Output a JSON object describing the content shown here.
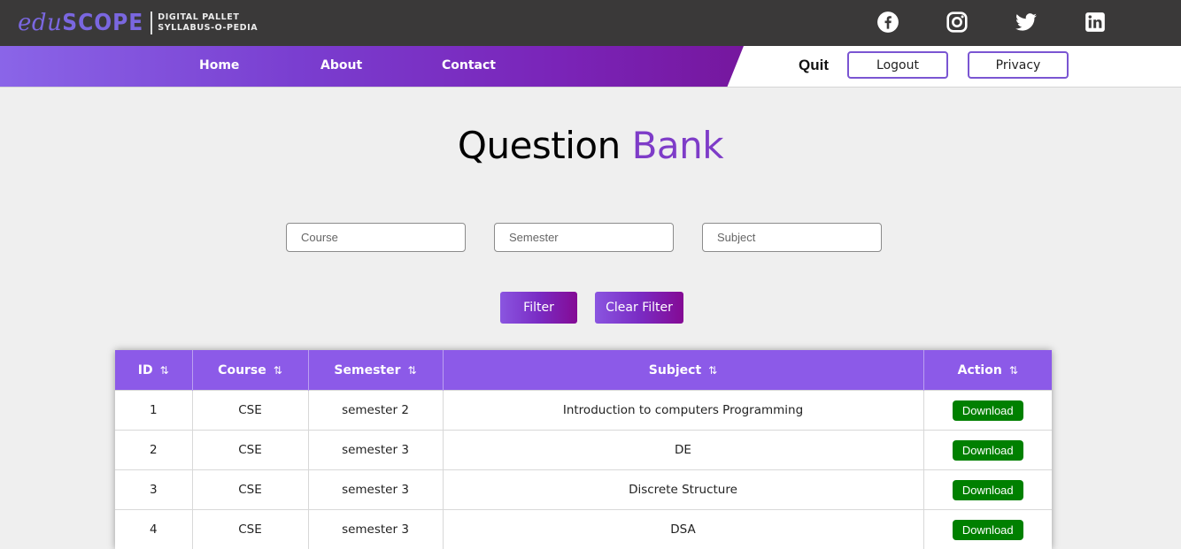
{
  "logo": {
    "main_lower": "edu",
    "main_upper": "SCOPE",
    "sub_line1": "DIGITAL PALLET",
    "sub_line2": "SYLLABUS-O-PEDIA"
  },
  "socials": [
    {
      "icon": "facebook-icon"
    },
    {
      "icon": "instagram-icon"
    },
    {
      "icon": "twitter-icon"
    },
    {
      "icon": "linkedin-icon"
    }
  ],
  "nav": {
    "links": [
      "Home",
      "About",
      "Contact"
    ],
    "quit_label": "Quit",
    "logout_label": "Logout",
    "privacy_label": "Privacy"
  },
  "heading": {
    "part1": "Question",
    "part2": "Bank"
  },
  "filters": {
    "course_placeholder": "Course",
    "semester_placeholder": "Semester",
    "subject_placeholder": "Subject",
    "filter_label": "Filter",
    "clear_label": "Clear Filter"
  },
  "table": {
    "columns": [
      "ID",
      "Course",
      "Semester",
      "Subject",
      "Action"
    ],
    "sort_glyph": "⇅",
    "rows": [
      {
        "id": "1",
        "course": "CSE",
        "semester": "semester 2",
        "subject": "Introduction to computers Programming",
        "action": "Download"
      },
      {
        "id": "2",
        "course": "CSE",
        "semester": "semester 3",
        "subject": "DE",
        "action": "Download"
      },
      {
        "id": "3",
        "course": "CSE",
        "semester": "semester 3",
        "subject": "Discrete Structure",
        "action": "Download"
      },
      {
        "id": "4",
        "course": "CSE",
        "semester": "semester 3",
        "subject": "DSA",
        "action": "Download"
      }
    ]
  },
  "colors": {
    "accent": "#7e3cc8",
    "header_bg": "#8c5ae8",
    "download_bg": "#008000",
    "topbar_bg": "#3a3939"
  }
}
